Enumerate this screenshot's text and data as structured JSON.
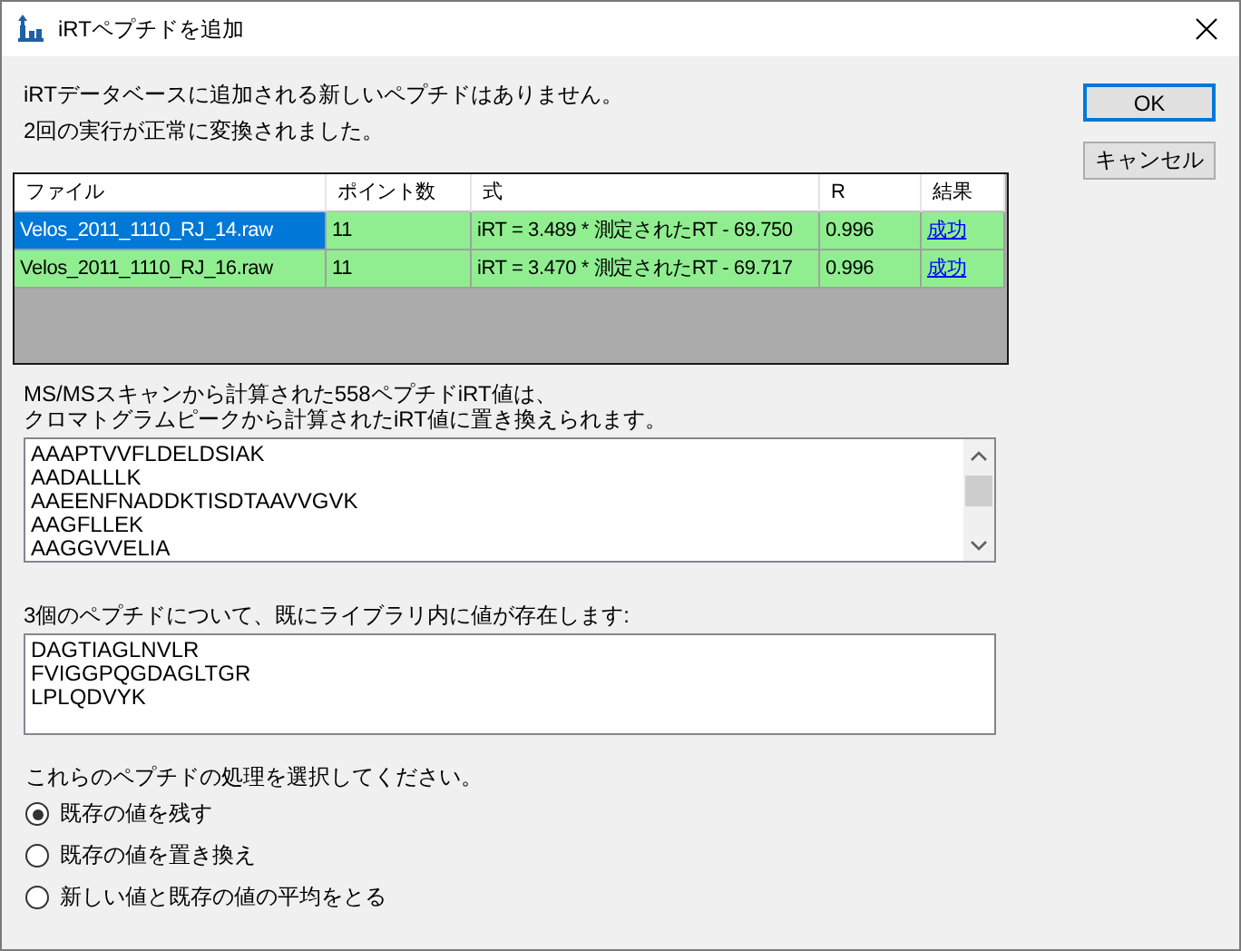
{
  "window": {
    "title": "iRTペプチドを追加"
  },
  "messages": [
    "iRTデータベースに追加される新しいペプチドはありません。",
    "2回の実行が正常に変換されました。"
  ],
  "buttons": [
    {
      "label": "OK",
      "default": true
    },
    {
      "label": "キャンセル",
      "default": false
    }
  ],
  "table": {
    "columns": [
      "ファイル",
      "ポイント数",
      "式",
      "R",
      "結果"
    ],
    "rows": [
      {
        "file": "Velos_2011_1110_RJ_14.raw",
        "points": "11",
        "formula": "iRT = 3.489 * 測定されたRT - 69.750",
        "r": "0.996",
        "result": "成功",
        "selected": true
      },
      {
        "file": "Velos_2011_1110_RJ_16.raw",
        "points": "11",
        "formula": "iRT = 3.470 * 測定されたRT - 69.717",
        "r": "0.996",
        "result": "成功",
        "selected": false
      }
    ]
  },
  "recalc": {
    "label": [
      "MS/MSスキャンから計算された558ペプチドiRT値は、",
      "クロマトグラムピークから計算されたiRT値に置き換えられます。"
    ],
    "items": [
      "AAAPTVVFLDELDSIAK",
      "AADALLLK",
      "AAEENFNADDKTISDTAAVVGVK",
      "AAGFLLEK",
      "AAGGVVELIA"
    ]
  },
  "existing": {
    "label": "3個のペプチドについて、既にライブラリ内に値が存在します:",
    "items": [
      "DAGTIAGLNVLR",
      "FVIGGPQGDAGLTGR",
      "LPLQDVYK"
    ]
  },
  "choice": {
    "label": "これらのペプチドの処理を選択してください。",
    "options": [
      {
        "label": "既存の値を残す",
        "selected": true
      },
      {
        "label": "既存の値を置き換え",
        "selected": false
      },
      {
        "label": "新しい値と既存の値の平均をとる",
        "selected": false
      }
    ]
  }
}
